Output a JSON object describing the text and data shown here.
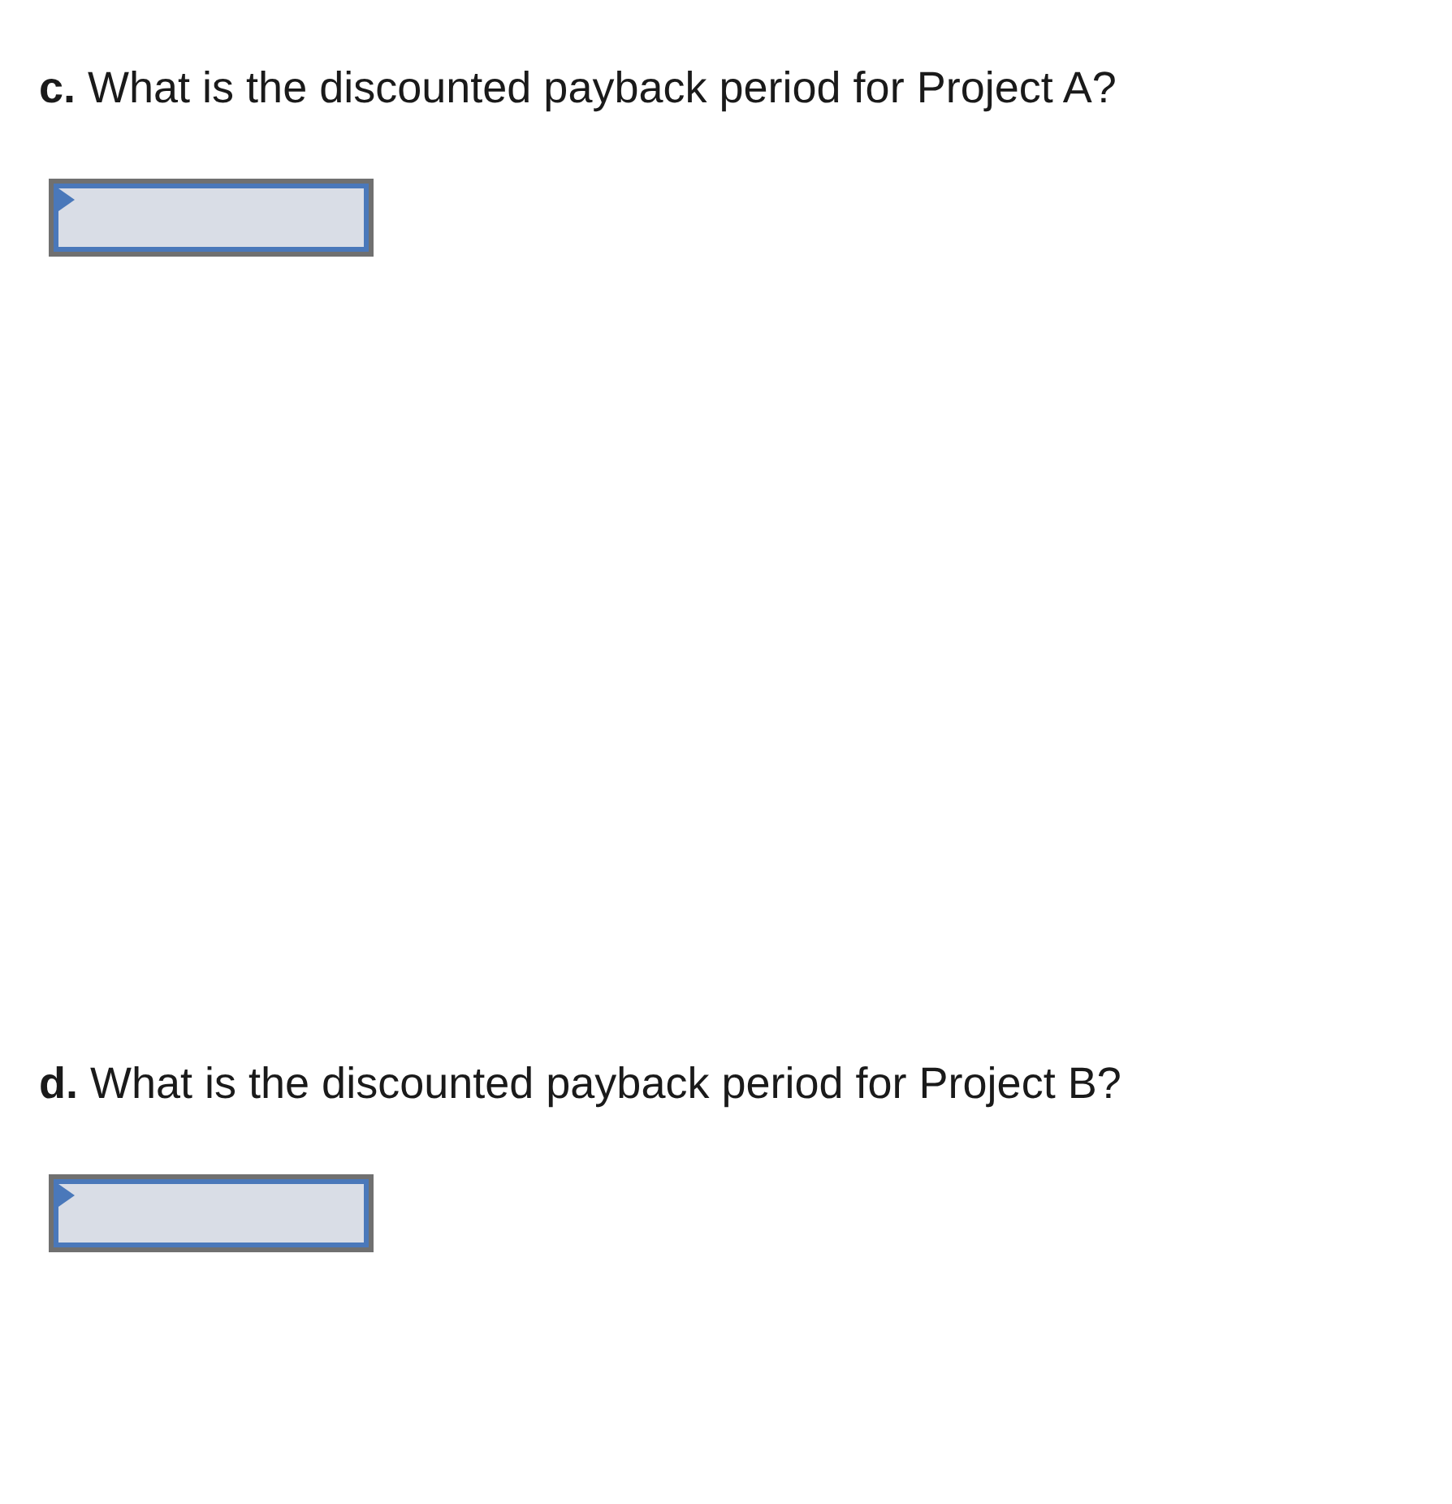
{
  "questions": [
    {
      "label": "c.",
      "text": "What is the discounted payback period for Project A?",
      "kind": "text-entry"
    },
    {
      "label": "d.",
      "text": "What is the discounted payback period for Project B?",
      "kind": "text-entry"
    }
  ]
}
